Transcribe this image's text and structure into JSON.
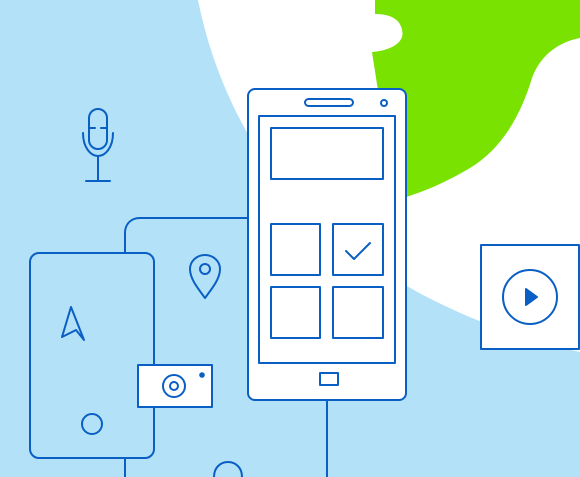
{
  "illustration": {
    "colors": {
      "background": "#b3e1f8",
      "white_shape": "#ffffff",
      "accent_green": "#79e200",
      "stroke": "#0a5fc4"
    },
    "icons": [
      "microphone-icon",
      "location-pin-icon",
      "navigation-arrow-icon",
      "camera-icon",
      "checkmark-icon",
      "play-icon",
      "smartphone-icon",
      "tablet-icon"
    ]
  }
}
